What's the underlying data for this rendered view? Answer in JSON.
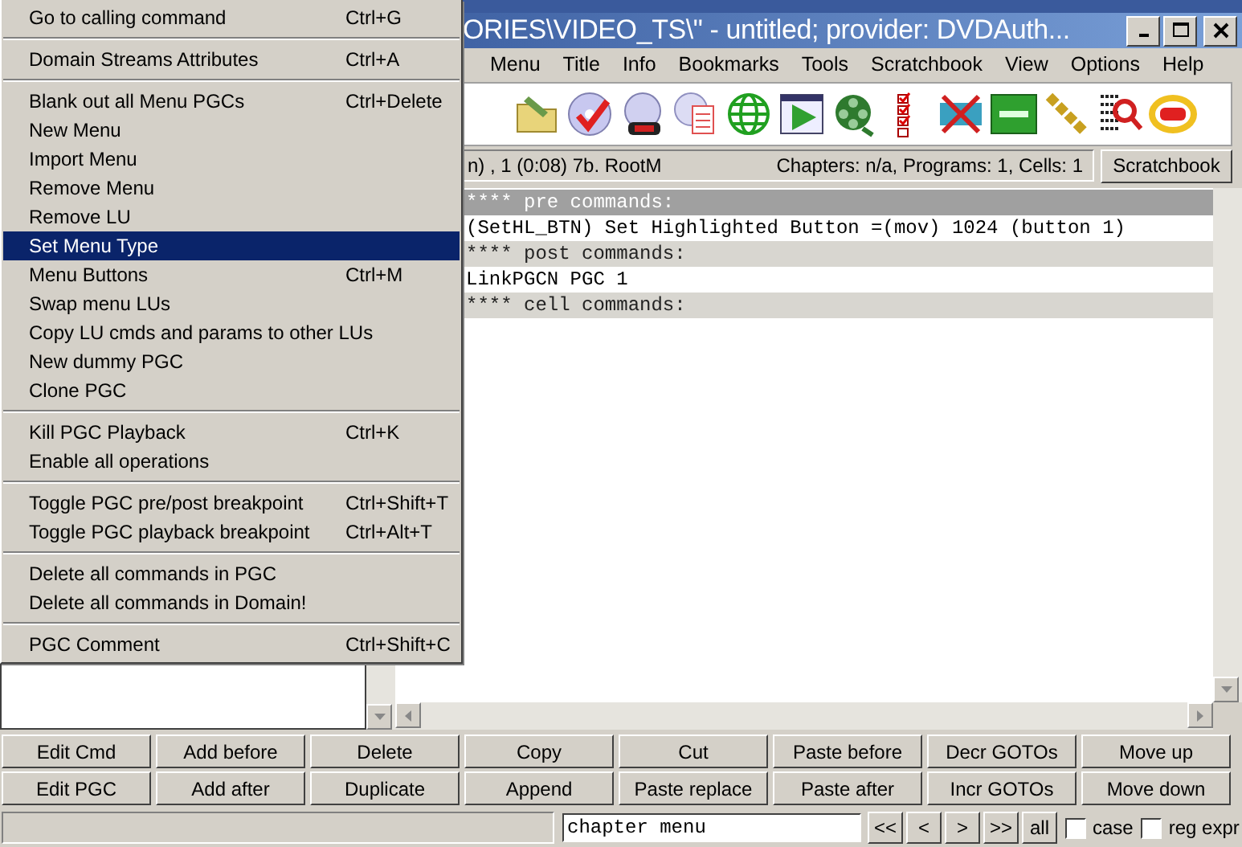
{
  "window": {
    "title": "ORIES\\VIDEO_TS\\\" - untitled; provider: DVDAuth..."
  },
  "menubar": [
    "Menu",
    "Title",
    "Info",
    "Bookmarks",
    "Tools",
    "Scratchbook",
    "View",
    "Options",
    "Help"
  ],
  "status": {
    "position": "n) , 1  (0:08)  7b.  RootM",
    "chapters": "Chapters: n/a,  Programs: 1,  Cells: 1",
    "button": "Scratchbook"
  },
  "commands": [
    {
      "kind": "header",
      "text": "**** pre commands:"
    },
    {
      "kind": "command",
      "text": "(SetHL_BTN) Set Highlighted Button =(mov) 1024 (button 1)"
    },
    {
      "kind": "header",
      "text": "**** post commands:"
    },
    {
      "kind": "command",
      "text": "LinkPGCN PGC 1"
    },
    {
      "kind": "header",
      "text": "**** cell commands:"
    }
  ],
  "buttons": [
    [
      "Edit Cmd",
      "Add before",
      "Delete",
      "Copy",
      "Cut",
      "Paste before",
      "Decr GOTOs",
      "Move up"
    ],
    [
      "Edit PGC",
      "Add after",
      "Duplicate",
      "Append",
      "Paste replace",
      "Paste after",
      "Incr GOTOs",
      "Move down"
    ]
  ],
  "search": {
    "value": "chapter menu",
    "nav": [
      "<<",
      "<",
      ">",
      ">>",
      "all"
    ],
    "options": [
      {
        "label": "case",
        "checked": false
      },
      {
        "label": "reg expr",
        "checked": false
      }
    ]
  },
  "context_menu": [
    [
      {
        "label": "Go to calling command",
        "shortcut": "Ctrl+G",
        "selected": false
      }
    ],
    [
      {
        "label": "Domain Streams Attributes",
        "shortcut": "Ctrl+A",
        "selected": false
      }
    ],
    [
      {
        "label": "Blank out all Menu PGCs",
        "shortcut": "Ctrl+Delete",
        "selected": false
      },
      {
        "label": "New Menu",
        "selected": false
      },
      {
        "label": "Import Menu",
        "selected": false
      },
      {
        "label": "Remove Menu",
        "selected": false
      },
      {
        "label": "Remove LU",
        "selected": false
      },
      {
        "label": "Set Menu Type",
        "selected": true
      },
      {
        "label": "Menu Buttons",
        "shortcut": "Ctrl+M",
        "selected": false
      },
      {
        "label": "Swap menu LUs",
        "selected": false
      },
      {
        "label": "Copy LU cmds and params to other LUs",
        "selected": false
      },
      {
        "label": "New dummy PGC",
        "selected": false
      },
      {
        "label": "Clone PGC",
        "selected": false
      }
    ],
    [
      {
        "label": "Kill PGC Playback",
        "shortcut": "Ctrl+K",
        "selected": false
      },
      {
        "label": "Enable all operations",
        "selected": false
      }
    ],
    [
      {
        "label": "Toggle PGC pre/post breakpoint",
        "shortcut": "Ctrl+Shift+T",
        "selected": false
      },
      {
        "label": "Toggle PGC playback breakpoint",
        "shortcut": "Ctrl+Alt+T",
        "selected": false
      }
    ],
    [
      {
        "label": "Delete all commands in PGC",
        "selected": false
      },
      {
        "label": "Delete all commands in Domain!",
        "selected": false
      }
    ],
    [
      {
        "label": "PGC Comment",
        "shortcut": "Ctrl+Shift+C",
        "selected": false
      }
    ]
  ]
}
